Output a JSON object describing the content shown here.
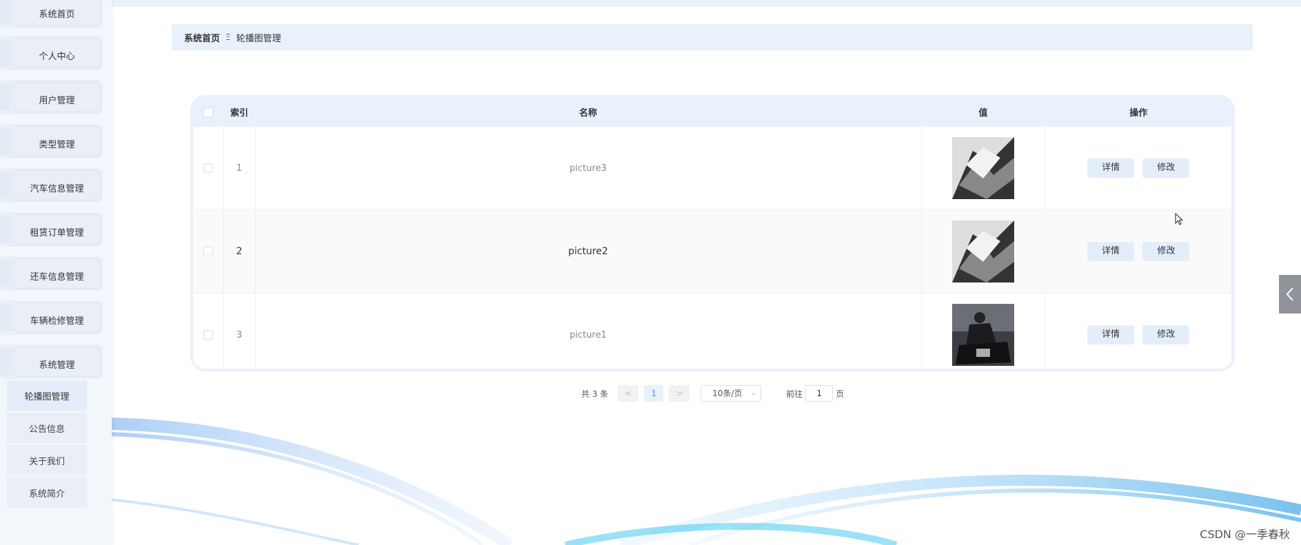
{
  "sidebar": {
    "items": [
      {
        "label": "系统首页"
      },
      {
        "label": "个人中心"
      },
      {
        "label": "用户管理"
      },
      {
        "label": "类型管理"
      },
      {
        "label": "汽车信息管理"
      },
      {
        "label": "租赁订单管理"
      },
      {
        "label": "还车信息管理"
      },
      {
        "label": "车辆检修管理"
      },
      {
        "label": "系统管理"
      }
    ],
    "sub_items": [
      {
        "label": "轮播图管理",
        "active": true
      },
      {
        "label": "公告信息"
      },
      {
        "label": "关于我们"
      },
      {
        "label": "系统简介"
      }
    ]
  },
  "breadcrumb": {
    "home": "系统首页",
    "separator": "Ξ",
    "current": "轮播图管理"
  },
  "table": {
    "headers": {
      "index": "索引",
      "name": "名称",
      "value": "值",
      "actions": "操作"
    },
    "rows": [
      {
        "index": "1",
        "name": "picture3",
        "detail": "详情",
        "edit": "修改"
      },
      {
        "index": "2",
        "name": "picture2",
        "detail": "详情",
        "edit": "修改"
      },
      {
        "index": "3",
        "name": "picture1",
        "detail": "详情",
        "edit": "修改"
      }
    ]
  },
  "pagination": {
    "total": "共 3 条",
    "prev": "<",
    "current_page": "1",
    "next": ">",
    "page_size": "10条/页",
    "goto_label": "前往",
    "goto_value": "1",
    "page_suffix": "页"
  },
  "watermark": "CSDN @一季春秋",
  "colors": {
    "accent": "#409eff",
    "header_bg": "#e8f1fc",
    "button_bg": "#e4eefb"
  }
}
